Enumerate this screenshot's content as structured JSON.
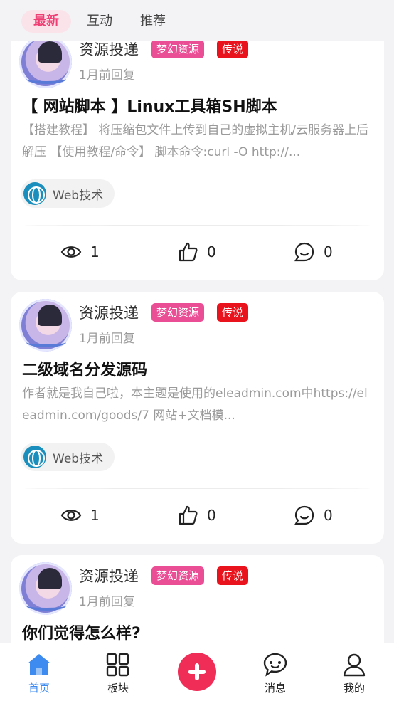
{
  "top_tabs": [
    {
      "label": "最新",
      "active": true
    },
    {
      "label": "互动",
      "active": false
    },
    {
      "label": "推荐",
      "active": false
    }
  ],
  "posts": [
    {
      "author": "资源投递",
      "badges": [
        "梦幻资源",
        "传说"
      ],
      "time": "1月前回复",
      "title": "【 网站脚本 】Linux工具箱SH脚本",
      "excerpt": "【搭建教程】 将压缩包文件上传到自己的虚拟主机/云服务器上后解压 【使用教程/命令】 脚本命令:curl -O http://...",
      "tag": "Web技术",
      "views": "1",
      "likes": "0",
      "comments": "0"
    },
    {
      "author": "资源投递",
      "badges": [
        "梦幻资源",
        "传说"
      ],
      "time": "1月前回复",
      "title": "二级域名分发源码",
      "excerpt": "作者就是我自己啦，本主题是使用的eleadmin.com中https://eleadmin.com/goods/7 网站+文档模...",
      "tag": "Web技术",
      "views": "1",
      "likes": "0",
      "comments": "0"
    },
    {
      "author": "资源投递",
      "badges": [
        "梦幻资源",
        "传说"
      ],
      "time": "1月前回复",
      "title": "你们觉得怎么样?"
    }
  ],
  "bottom_nav": [
    {
      "label": "首页",
      "icon": "home-icon",
      "active": true
    },
    {
      "label": "板块",
      "icon": "grid-icon"
    },
    {
      "label": "",
      "icon": "plus-icon"
    },
    {
      "label": "消息",
      "icon": "chat-icon"
    },
    {
      "label": "我的",
      "icon": "user-icon"
    }
  ],
  "colors": {
    "accent_pink": "#ee3e73",
    "badge_pink": "#ea4f95",
    "badge_red": "#e8131c",
    "nav_active": "#3d8bf0",
    "plus_red": "#ef2d57"
  }
}
